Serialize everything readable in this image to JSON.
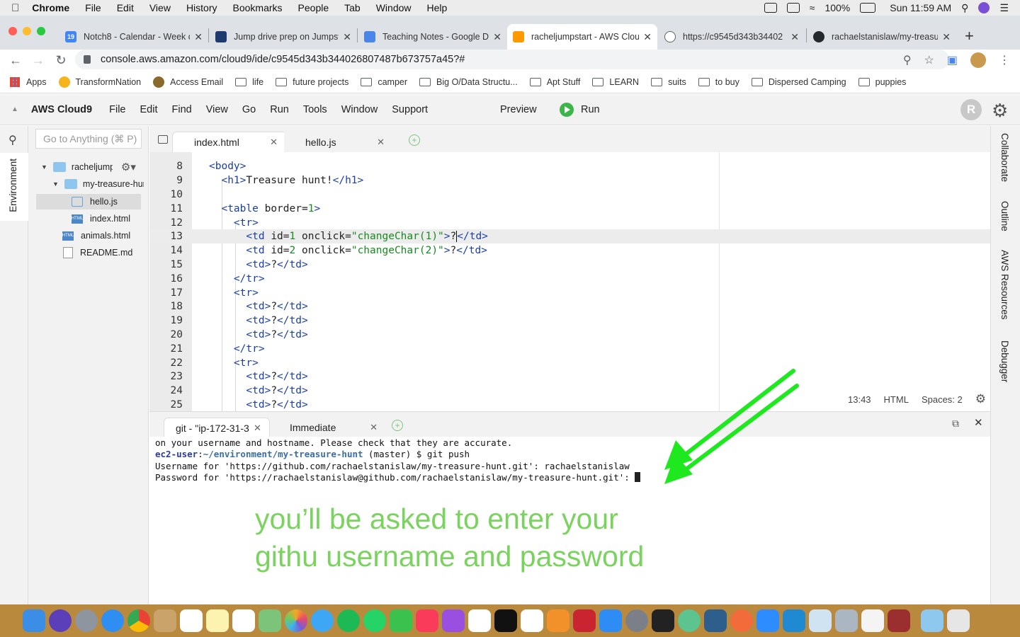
{
  "menubar": {
    "app": "Chrome",
    "items": [
      "File",
      "Edit",
      "View",
      "History",
      "Bookmarks",
      "People",
      "Tab",
      "Window",
      "Help"
    ],
    "battery": "100%",
    "datetime": "Sun 11:59 AM"
  },
  "browser": {
    "tabs": [
      {
        "title": "Notch8 - Calendar - Week o",
        "color": "#4285f4"
      },
      {
        "title": "Jump drive prep on Jumpst",
        "color": "#1f3b6e"
      },
      {
        "title": "Teaching Notes - Google D",
        "color": "#4a86e8"
      },
      {
        "title": "racheljumpstart - AWS Clou",
        "color": "#ff9900"
      },
      {
        "title": "https://c9545d343b34402",
        "color": "#5f6368"
      },
      {
        "title": "rachaelstanislaw/my-treasu",
        "color": "#24292e"
      }
    ],
    "url": "console.aws.amazon.com/cloud9/ide/c9545d343b344026807487b673757a45?#",
    "bookmarks": [
      "Apps",
      "TransformNation",
      "Access Email",
      "life",
      "future projects",
      "camper",
      "Big O/Data Structu...",
      "Apt Stuff",
      "LEARN",
      "suits",
      "to buy",
      "Dispersed Camping",
      "puppies"
    ]
  },
  "ide": {
    "brand": "AWS Cloud9",
    "menu": [
      "File",
      "Edit",
      "Find",
      "View",
      "Go",
      "Run",
      "Tools",
      "Window",
      "Support"
    ],
    "preview": "Preview",
    "run": "Run",
    "user_initial": "R",
    "search_placeholder": "Go to Anything (⌘ P)",
    "left_rail_label": "Environment",
    "right_rail_labels": [
      "Collaborate",
      "Outline",
      "AWS Resources",
      "Debugger"
    ],
    "tree": {
      "root": "racheljumpstart",
      "folder": "my-treasure-hunt",
      "files_in_folder": [
        "hello.js",
        "index.html"
      ],
      "root_files": [
        "animals.html",
        "README.md"
      ]
    },
    "editor_tabs": [
      "index.html",
      "hello.js"
    ],
    "status": {
      "cursor": "13:43",
      "mode": "HTML",
      "spaces": "Spaces: 2"
    },
    "terminal_tabs": [
      "git - \"ip-172-31-3",
      "Immediate"
    ]
  },
  "terminal": {
    "line1": "on your username and hostname. Please check that they are accurate.",
    "prompt_user": "ec2-user",
    "prompt_path": "~/environment/my-treasure-hunt",
    "prompt_rest": " (master) $ git push",
    "line3": "Username for 'https://github.com/rachaelstanislaw/my-treasure-hunt.git': rachaelstanislaw",
    "line4": "Password for 'https://rachaelstanislaw@github.com/rachaelstanislaw/my-treasure-hunt.git': "
  },
  "annotation": {
    "line1": "you’ll be asked to enter your",
    "line2": "githu username and password",
    "color": "#7bd35f"
  }
}
